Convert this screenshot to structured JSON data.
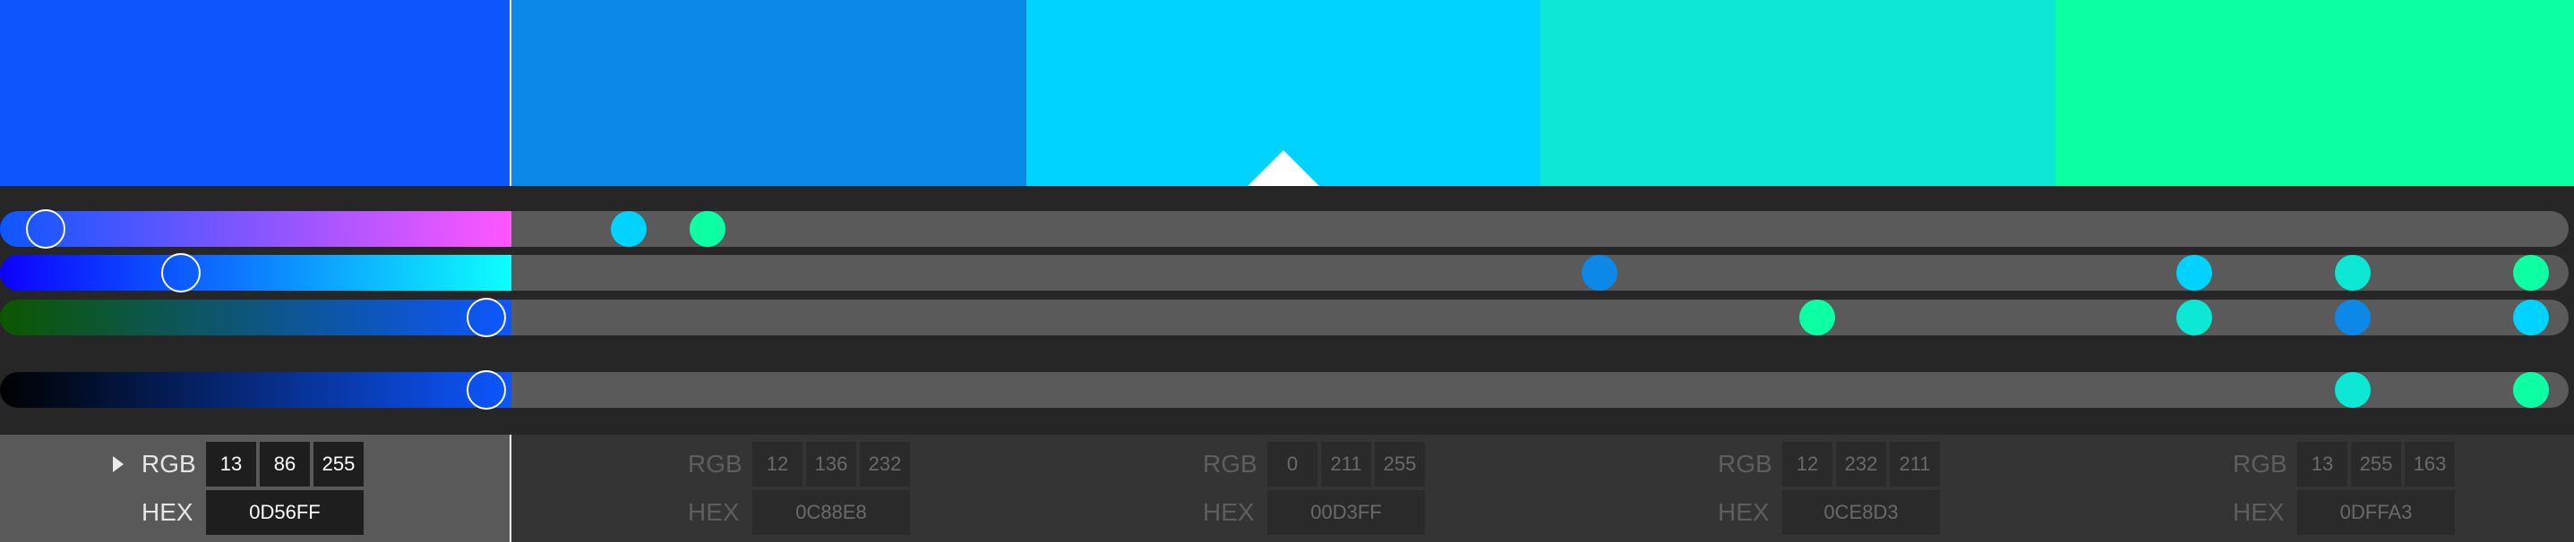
{
  "swatches": [
    {
      "color": "#0D56FF",
      "rgb": [
        "13",
        "86",
        "255"
      ],
      "hex": "0D56FF",
      "active": true,
      "slider_levels": [
        0.08,
        0.35,
        0.96,
        0.96
      ]
    },
    {
      "color": "#0C88E8",
      "rgb": [
        "12",
        "136",
        "232"
      ],
      "hex": "0C88E8",
      "active": false,
      "slider_levels": [
        0.08,
        0.53,
        0.91,
        0.91
      ]
    },
    {
      "color": "#00D3FF",
      "rgb": [
        "0",
        "211",
        "255"
      ],
      "hex": "00D3FF",
      "active": false,
      "slider_levels": [
        0.04,
        0.83,
        1.0,
        1.0
      ]
    },
    {
      "color": "#0CE8D3",
      "rgb": [
        "12",
        "232",
        "211"
      ],
      "hex": "0CE8D3",
      "active": false,
      "slider_levels": [
        0.08,
        0.91,
        0.83,
        0.91
      ]
    },
    {
      "color": "#0DFFA3",
      "rgb": [
        "13",
        "255",
        "163"
      ],
      "hex": "0DFFA3",
      "active": false,
      "slider_levels": [
        0.08,
        1.0,
        0.64,
        1.0
      ]
    }
  ],
  "labels": {
    "rgb": "RGB",
    "hex": "HEX"
  },
  "icons": {
    "expand": "play-triangle-icon",
    "selected_marker": "triangle-up-icon"
  }
}
